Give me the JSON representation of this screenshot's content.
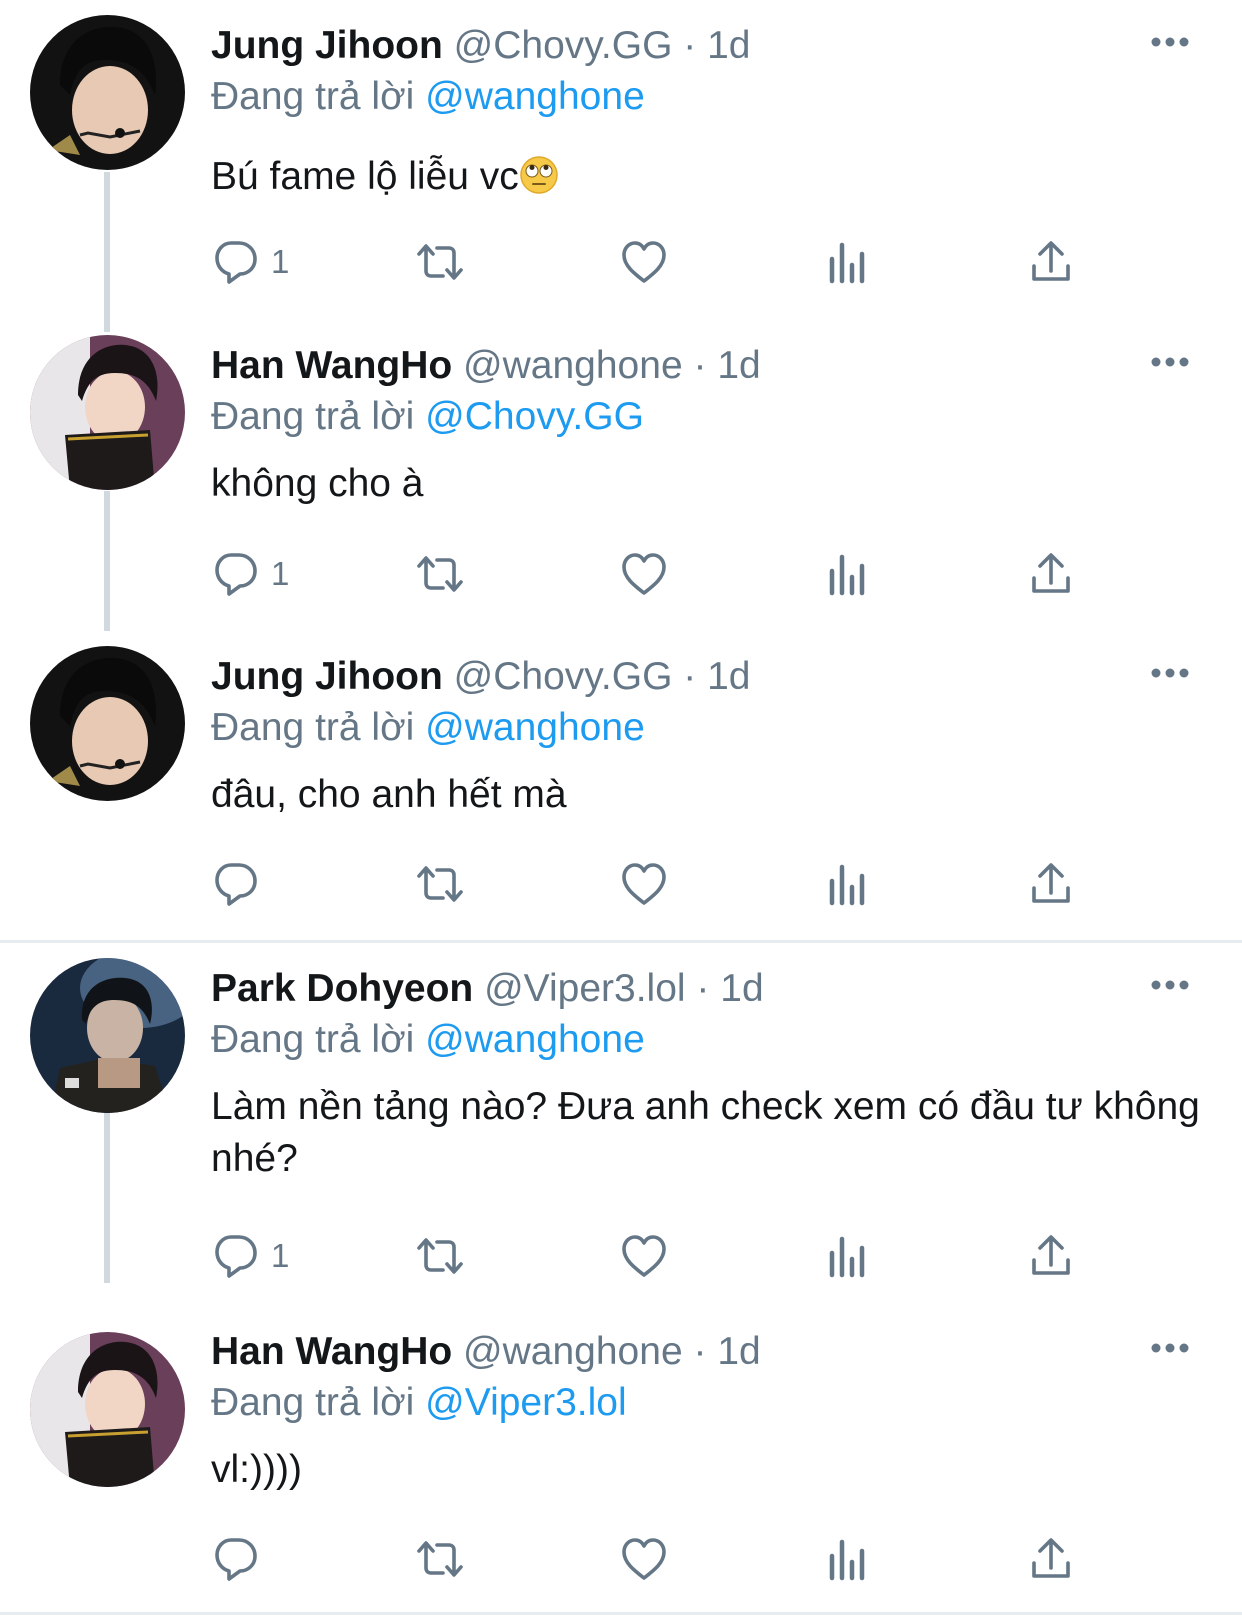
{
  "labels": {
    "replying_to": "Đang trả lời"
  },
  "colors": {
    "mention": "#1d9bf0",
    "secondary": "#657786",
    "thread_line": "#cfd9de"
  },
  "tweets": [
    {
      "name": "Jung Jihoon",
      "handle": "@Chovy.GG",
      "sep": "·",
      "time": "1d",
      "reply_to": "@wanghone",
      "text": "Bú fame lộ liễu vc",
      "emoji": "face-with-rolling-eyes-emoji",
      "reply_count": "1"
    },
    {
      "name": "Han WangHo",
      "handle": "@wanghone",
      "sep": "·",
      "time": "1d",
      "reply_to": "@Chovy.GG",
      "text": "không cho à",
      "reply_count": "1"
    },
    {
      "name": "Jung Jihoon",
      "handle": "@Chovy.GG",
      "sep": "·",
      "time": "1d",
      "reply_to": "@wanghone",
      "text": "đâu, cho anh hết mà",
      "reply_count": ""
    },
    {
      "name": "Park Dohyeon",
      "handle": "@Viper3.lol",
      "sep": "·",
      "time": "1d",
      "reply_to": "@wanghone",
      "text": "Làm nền tảng nào? Đưa anh check xem có đầu tư không nhé?",
      "reply_count": "1"
    },
    {
      "name": "Han WangHo",
      "handle": "@wanghone",
      "sep": "·",
      "time": "1d",
      "reply_to": "@Viper3.lol",
      "text": "vl:))))",
      "reply_count": ""
    }
  ],
  "icons": {
    "more": "more-horizontal-icon",
    "reply": "reply-bubble-icon",
    "retweet": "retweet-icon",
    "like": "heart-icon",
    "analytics": "analytics-bars-icon",
    "share": "share-upload-icon"
  }
}
